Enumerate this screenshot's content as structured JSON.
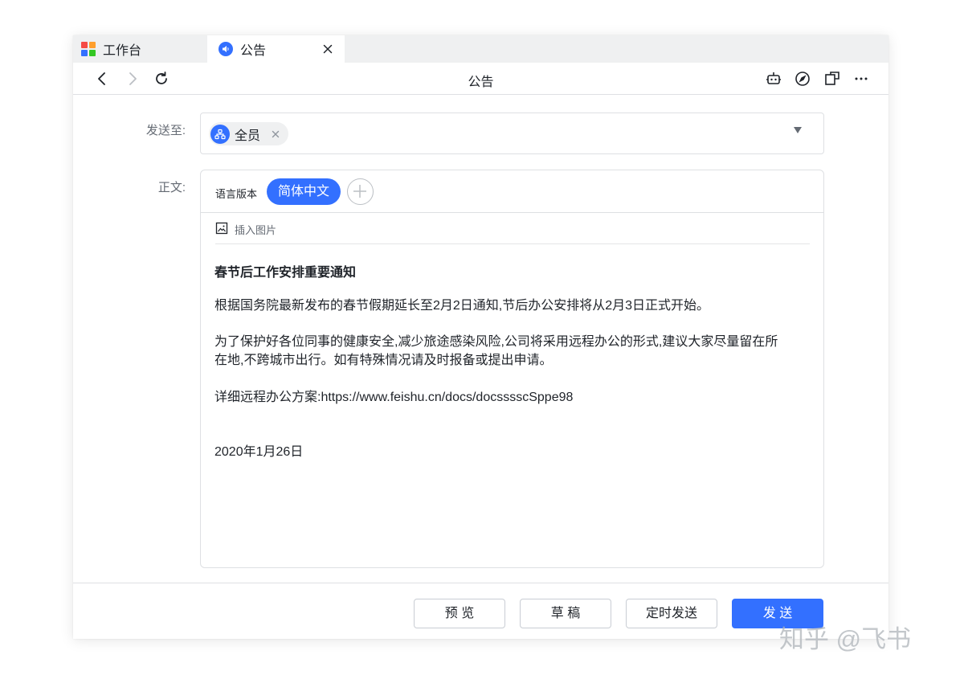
{
  "tabs": {
    "workbench": {
      "label": "工作台"
    },
    "announcement": {
      "label": "公告"
    }
  },
  "toolbar": {
    "title": "公告",
    "icons": [
      "chevron-left-icon",
      "chevron-right-icon",
      "refresh-icon",
      "bot-icon",
      "compass-icon",
      "window-icon",
      "more-icon"
    ]
  },
  "form": {
    "send_to_label": "发送至:",
    "recipient_chip": "全员",
    "body_label": "正文:"
  },
  "editor": {
    "language_version_label": "语言版本",
    "active_language": "简体中文",
    "insert_image_label": "插入图片",
    "content": {
      "title": "春节后工作安排重要通知",
      "paragraph1": "根据国务院最新发布的春节假期延长至2月2日通知,节后办公安排将从2月3日正式开始。",
      "paragraph2_line1": "为了保护好各位同事的健康安全,减少旅途感染风险,公司将采用远程办公的形式,建议大家尽量留在所",
      "paragraph2_line2": "在地,不跨城市出行。如有特殊情况请及时报备或提出申请。",
      "plan_link": "详细远程办公方案:https://www.feishu.cn/docs/docsssscSppe98",
      "date": "2020年1月26日"
    }
  },
  "footer": {
    "preview_label": "预 览",
    "draft_label": "草 稿",
    "schedule_label": "定时发送",
    "send_label": "发 送"
  },
  "watermark": "知乎 @飞书",
  "colors": {
    "accent": "#3370ff",
    "border": "#dee0e3",
    "text_primary": "#1f2329",
    "text_secondary": "#646a73",
    "logo_red": "#f54a45",
    "logo_orange": "#ff9f2d",
    "logo_blue": "#3370ff",
    "logo_green": "#34c724"
  }
}
